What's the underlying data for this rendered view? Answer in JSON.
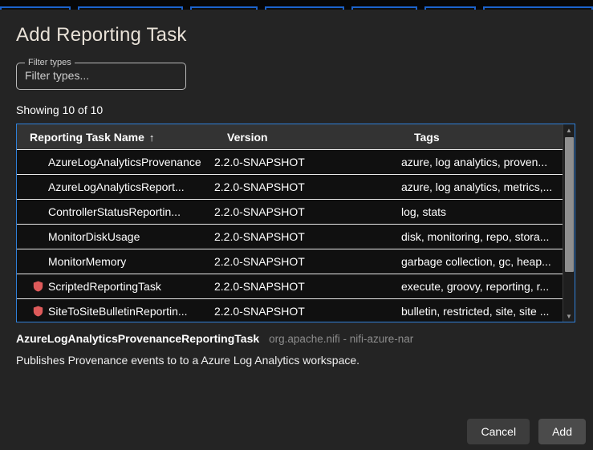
{
  "dialog": {
    "title": "Add Reporting Task",
    "filter": {
      "label": "Filter types",
      "placeholder": "Filter types...",
      "value": ""
    },
    "showing_text": "Showing 10 of 10",
    "table": {
      "columns": {
        "name": "Reporting Task Name",
        "version": "Version",
        "tags": "Tags"
      },
      "sort_icon": "↑",
      "rows": [
        {
          "name": "AzureLogAnalyticsProvenance",
          "version": "2.2.0-SNAPSHOT",
          "tags": "azure, log analytics, proven...",
          "restricted": false
        },
        {
          "name": "AzureLogAnalyticsReport...",
          "version": "2.2.0-SNAPSHOT",
          "tags": "azure, log analytics, metrics,...",
          "restricted": false
        },
        {
          "name": "ControllerStatusReportin...",
          "version": "2.2.0-SNAPSHOT",
          "tags": "log, stats",
          "restricted": false
        },
        {
          "name": "MonitorDiskUsage",
          "version": "2.2.0-SNAPSHOT",
          "tags": "disk, monitoring, repo, stora...",
          "restricted": false
        },
        {
          "name": "MonitorMemory",
          "version": "2.2.0-SNAPSHOT",
          "tags": "garbage collection, gc, heap...",
          "restricted": false
        },
        {
          "name": "ScriptedReportingTask",
          "version": "2.2.0-SNAPSHOT",
          "tags": "execute, groovy, reporting, r...",
          "restricted": true
        },
        {
          "name": "SiteToSiteBulletinReportin...",
          "version": "2.2.0-SNAPSHOT",
          "tags": "bulletin, restricted, site, site ...",
          "restricted": true
        }
      ]
    },
    "selected": {
      "name": "AzureLogAnalyticsProvenanceReportingTask",
      "bundle": "org.apache.nifi - nifi-azure-nar",
      "description": "Publishes Provenance events to to a Azure Log Analytics workspace."
    },
    "actions": {
      "cancel_label": "Cancel",
      "add_label": "Add"
    }
  },
  "scrollbar": {
    "up_icon": "▲",
    "down_icon": "▼"
  },
  "colors": {
    "accent_blue": "#2f80d9",
    "restricted_red": "#de5a5a",
    "separator_white": "#e8e8e8"
  }
}
